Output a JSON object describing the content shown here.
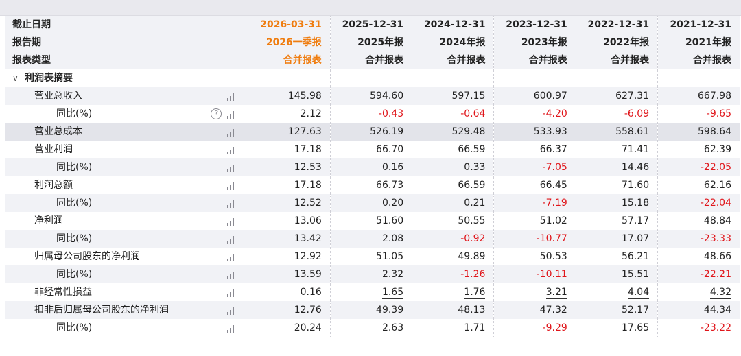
{
  "header": {
    "row1_label": "截止日期",
    "row2_label": "报告期",
    "row3_label": "报表类型",
    "columns": [
      {
        "date": "2026-03-31",
        "period": "2026一季报",
        "type": "合并报表",
        "current": true
      },
      {
        "date": "2025-12-31",
        "period": "2025年报",
        "type": "合并报表",
        "current": false
      },
      {
        "date": "2024-12-31",
        "period": "2024年报",
        "type": "合并报表",
        "current": false
      },
      {
        "date": "2023-12-31",
        "period": "2023年报",
        "type": "合并报表",
        "current": false
      },
      {
        "date": "2022-12-31",
        "period": "2022年报",
        "type": "合并报表",
        "current": false
      },
      {
        "date": "2021-12-31",
        "period": "2021年报",
        "type": "合并报表",
        "current": false
      }
    ]
  },
  "section": {
    "title": "利润表摘要",
    "chevron": "chevron-down-icon"
  },
  "rows": [
    {
      "label": "营业总收入",
      "indent": 1,
      "help": false,
      "values": [
        "145.98",
        "594.60",
        "597.15",
        "600.97",
        "627.31",
        "667.98"
      ]
    },
    {
      "label": "同比(%)",
      "indent": 2,
      "help": true,
      "values": [
        "2.12",
        "-0.43",
        "-0.64",
        "-4.20",
        "-6.09",
        "-9.65"
      ]
    },
    {
      "label": "营业总成本",
      "indent": 1,
      "help": false,
      "hover": true,
      "values": [
        "127.63",
        "526.19",
        "529.48",
        "533.93",
        "558.61",
        "598.64"
      ]
    },
    {
      "label": "营业利润",
      "indent": 1,
      "help": false,
      "values": [
        "17.18",
        "66.70",
        "66.59",
        "66.37",
        "71.41",
        "62.39"
      ]
    },
    {
      "label": "同比(%)",
      "indent": 2,
      "help": false,
      "values": [
        "12.53",
        "0.16",
        "0.33",
        "-7.05",
        "14.46",
        "-22.05"
      ]
    },
    {
      "label": "利润总额",
      "indent": 1,
      "help": false,
      "values": [
        "17.18",
        "66.73",
        "66.59",
        "66.45",
        "71.60",
        "62.16"
      ]
    },
    {
      "label": "同比(%)",
      "indent": 2,
      "help": false,
      "values": [
        "12.52",
        "0.20",
        "0.21",
        "-7.19",
        "15.18",
        "-22.04"
      ]
    },
    {
      "label": "净利润",
      "indent": 1,
      "help": false,
      "values": [
        "13.06",
        "51.60",
        "50.55",
        "51.02",
        "57.17",
        "48.84"
      ]
    },
    {
      "label": "同比(%)",
      "indent": 2,
      "help": false,
      "values": [
        "13.42",
        "2.08",
        "-0.92",
        "-10.77",
        "17.07",
        "-23.33"
      ]
    },
    {
      "label": "归属母公司股东的净利润",
      "indent": 1,
      "help": false,
      "values": [
        "12.92",
        "51.05",
        "49.89",
        "50.53",
        "56.21",
        "48.66"
      ]
    },
    {
      "label": "同比(%)",
      "indent": 2,
      "help": false,
      "values": [
        "13.59",
        "2.32",
        "-1.26",
        "-10.11",
        "15.51",
        "-22.21"
      ]
    },
    {
      "label": "非经常性损益",
      "indent": 1,
      "help": false,
      "underline": true,
      "values": [
        "0.16",
        "1.65",
        "1.76",
        "3.21",
        "4.04",
        "4.32"
      ]
    },
    {
      "label": "扣非后归属母公司股东的净利润",
      "indent": 1,
      "help": false,
      "values": [
        "12.76",
        "49.39",
        "48.13",
        "47.32",
        "52.17",
        "44.34"
      ]
    },
    {
      "label": "同比(%)",
      "indent": 2,
      "help": false,
      "values": [
        "20.24",
        "2.63",
        "1.71",
        "-9.29",
        "17.65",
        "-23.22"
      ]
    }
  ],
  "colors": {
    "current_period": "#ef7d10",
    "negative": "#e0161b",
    "header_bg": "#f1f2f6"
  },
  "icons": {
    "chart": "bar-chart-icon",
    "help": "help-circle-icon",
    "help_glyph": "?"
  }
}
